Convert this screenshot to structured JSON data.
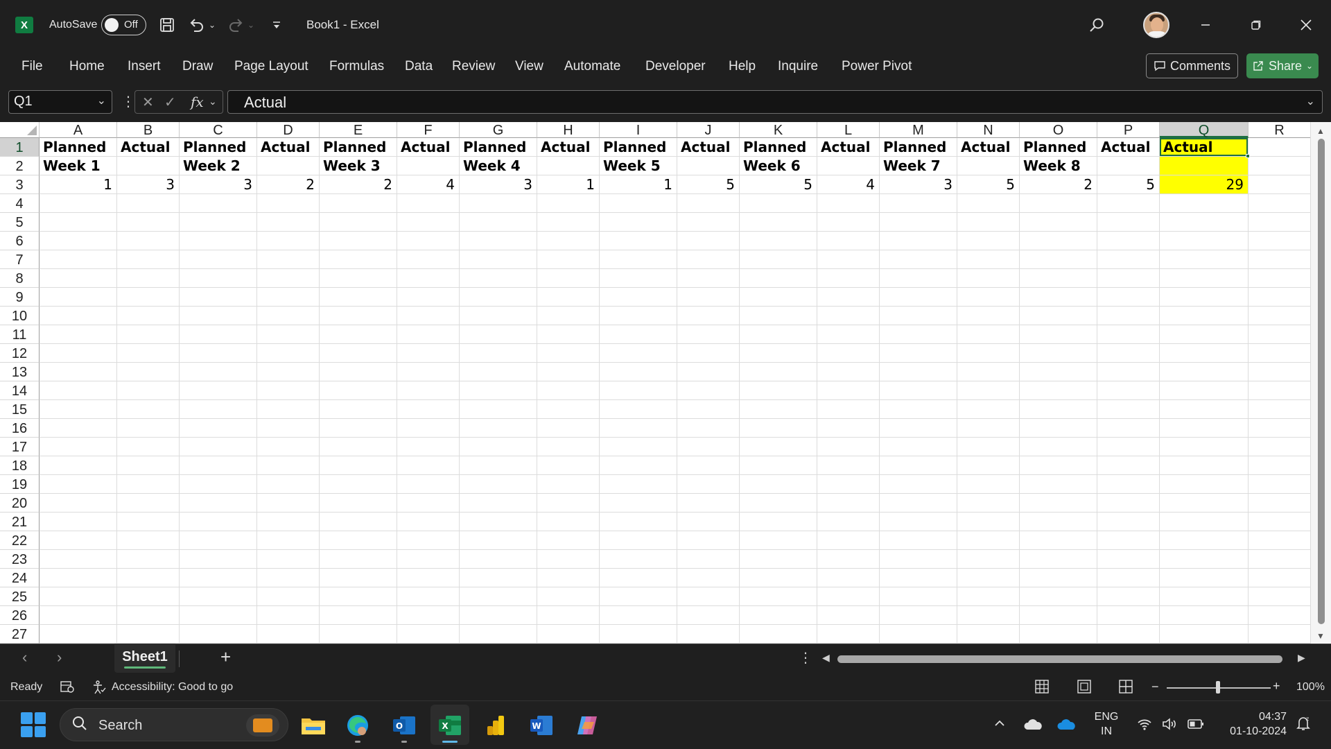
{
  "titlebar": {
    "app_icon": "X",
    "autosave_label": "AutoSave",
    "autosave_state": "Off",
    "title": "Book1  -  Excel"
  },
  "ribbon": {
    "tabs": [
      "File",
      "Home",
      "Insert",
      "Draw",
      "Page Layout",
      "Formulas",
      "Data",
      "Review",
      "View",
      "Automate",
      "Developer",
      "Help",
      "Inquire",
      "Power Pivot"
    ],
    "comments_label": "Comments",
    "share_label": "Share"
  },
  "formula_bar": {
    "name_box": "Q1",
    "fx": "fx",
    "formula": "Actual"
  },
  "grid": {
    "columns": [
      "A",
      "B",
      "C",
      "D",
      "E",
      "F",
      "G",
      "H",
      "I",
      "J",
      "K",
      "L",
      "M",
      "N",
      "O",
      "P",
      "Q",
      "R"
    ],
    "selected_column": "Q",
    "rows": [
      "1",
      "2",
      "3",
      "4",
      "5",
      "6",
      "7",
      "8",
      "9",
      "10",
      "11",
      "12",
      "13",
      "14",
      "15",
      "16",
      "17",
      "18",
      "19",
      "20",
      "21",
      "22",
      "23",
      "24",
      "25",
      "26",
      "27"
    ],
    "selected_row": "1",
    "row1": [
      "Planned",
      "Actual",
      "Planned",
      "Actual",
      "Planned",
      "Actual",
      "Planned",
      "Actual",
      "Planned",
      "Actual",
      "Planned",
      "Actual",
      "Planned",
      "Actual",
      "Planned",
      "Actual",
      "Actual"
    ],
    "row2": [
      "Week 1",
      "",
      "Week 2",
      "",
      "Week 3",
      "",
      "Week 4",
      "",
      "Week 5",
      "",
      "Week 6",
      "",
      "Week 7",
      "",
      "Week 8",
      "",
      ""
    ],
    "row3": [
      "1",
      "3",
      "3",
      "2",
      "2",
      "4",
      "3",
      "1",
      "1",
      "5",
      "5",
      "4",
      "3",
      "5",
      "2",
      "5",
      "29"
    ],
    "highlight_color": "#ffff00"
  },
  "sheets": {
    "tabs": [
      "Sheet1"
    ],
    "add_label": "+"
  },
  "status": {
    "ready": "Ready",
    "accessibility": "Accessibility: Good to go",
    "zoom": "100%"
  },
  "taskbar": {
    "search_label": "Search",
    "lang_line1": "ENG",
    "lang_line2": "IN",
    "time": "04:37",
    "date": "01-10-2024"
  }
}
